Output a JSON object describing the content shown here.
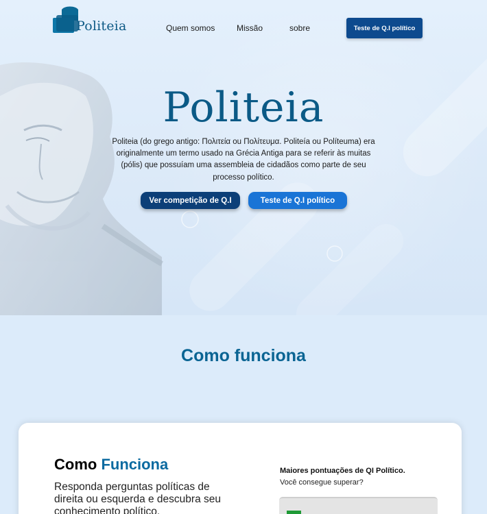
{
  "nav": {
    "brand": "Politeia",
    "links": [
      "Quem somos",
      "Missão",
      "sobre"
    ],
    "cta": "Teste de Q.I político"
  },
  "hero": {
    "title": "Politeia",
    "description": "Politeia (do grego antigo: Πολιτεία ou Πολίτευμα. Politeía ou Políteuma) era originalmente um termo usado na Grécia Antiga para se referir às muitas  (pólis) que possuíam uma assembleia de cidadãos como parte de seu processo político.",
    "buttons": {
      "primary": "Ver competição de Q.I",
      "secondary": "Teste de Q.I político"
    }
  },
  "how": {
    "section_title": "Como funciona",
    "card": {
      "title_part1": "Como ",
      "title_part2": "Funciona",
      "description": "Responda perguntas políticas de direita ou esquerda e descubra seu conhecimento político.",
      "ranking_title": "Maiores pontuações de QI Político.",
      "ranking_subtitle": "Você consegue superar?"
    }
  },
  "colors": {
    "brand": "#0b5a86",
    "nav_cta": "#0d4a8e",
    "btn_dark": "#0c3f78",
    "btn_light": "#1a74d6"
  }
}
